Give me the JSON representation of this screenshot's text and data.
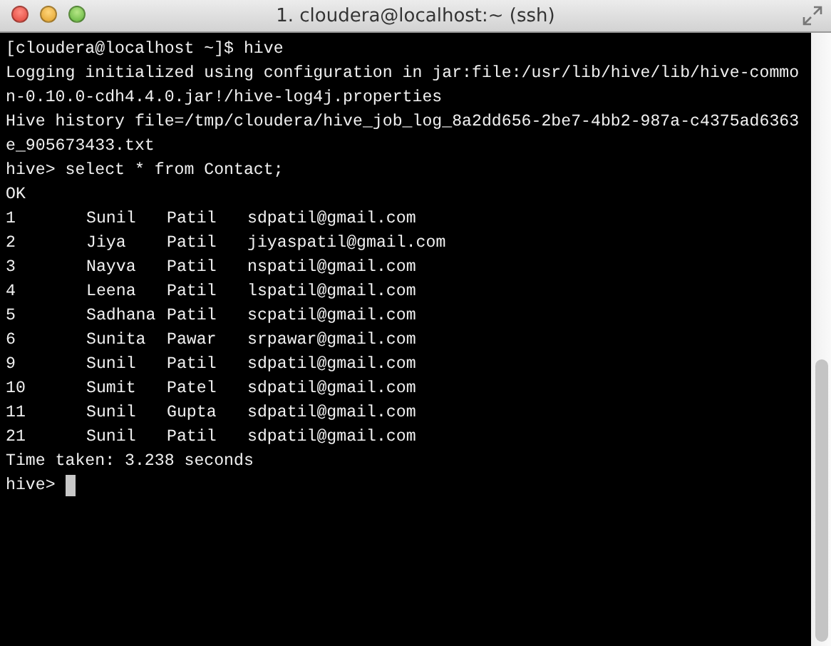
{
  "window": {
    "title": "1. cloudera@localhost:~ (ssh)"
  },
  "terminal": {
    "lines": [
      {
        "kind": "text",
        "text": "[cloudera@localhost ~]$ hive"
      },
      {
        "kind": "text",
        "text": "Logging initialized using configuration in jar:file:/usr/lib/hive/lib/hive-commo"
      },
      {
        "kind": "text",
        "text": "n-0.10.0-cdh4.4.0.jar!/hive-log4j.properties"
      },
      {
        "kind": "text",
        "text": "Hive history file=/tmp/cloudera/hive_job_log_8a2dd656-2be7-4bb2-987a-c4375ad6363"
      },
      {
        "kind": "text",
        "text": "e_905673433.txt"
      },
      {
        "kind": "text",
        "text": "hive> select * from Contact;"
      },
      {
        "kind": "text",
        "text": "OK"
      },
      {
        "kind": "row",
        "cells": [
          "1",
          "Sunil",
          "Patil",
          "sdpatil@gmail.com"
        ]
      },
      {
        "kind": "row",
        "cells": [
          "2",
          "Jiya",
          "Patil",
          "jiyaspatil@gmail.com"
        ]
      },
      {
        "kind": "row",
        "cells": [
          "3",
          "Nayva",
          "Patil",
          "nspatil@gmail.com"
        ]
      },
      {
        "kind": "row",
        "cells": [
          "4",
          "Leena",
          "Patil",
          "lspatil@gmail.com"
        ]
      },
      {
        "kind": "row",
        "cells": [
          "5",
          "Sadhana",
          "Patil",
          "scpatil@gmail.com"
        ]
      },
      {
        "kind": "row",
        "cells": [
          "6",
          "Sunita",
          "Pawar",
          "srpawar@gmail.com"
        ]
      },
      {
        "kind": "row",
        "cells": [
          "9",
          "Sunil",
          "Patil",
          "sdpatil@gmail.com"
        ]
      },
      {
        "kind": "row",
        "cells": [
          "10",
          "Sumit",
          "Patel",
          "sdpatil@gmail.com"
        ]
      },
      {
        "kind": "row",
        "cells": [
          "11",
          "Sunil",
          "Gupta",
          "sdpatil@gmail.com"
        ]
      },
      {
        "kind": "row",
        "cells": [
          "21",
          "Sunil",
          "Patil",
          "sdpatil@gmail.com"
        ]
      },
      {
        "kind": "text",
        "text": "Time taken: 3.238 seconds"
      },
      {
        "kind": "prompt",
        "text": "hive>"
      }
    ]
  }
}
